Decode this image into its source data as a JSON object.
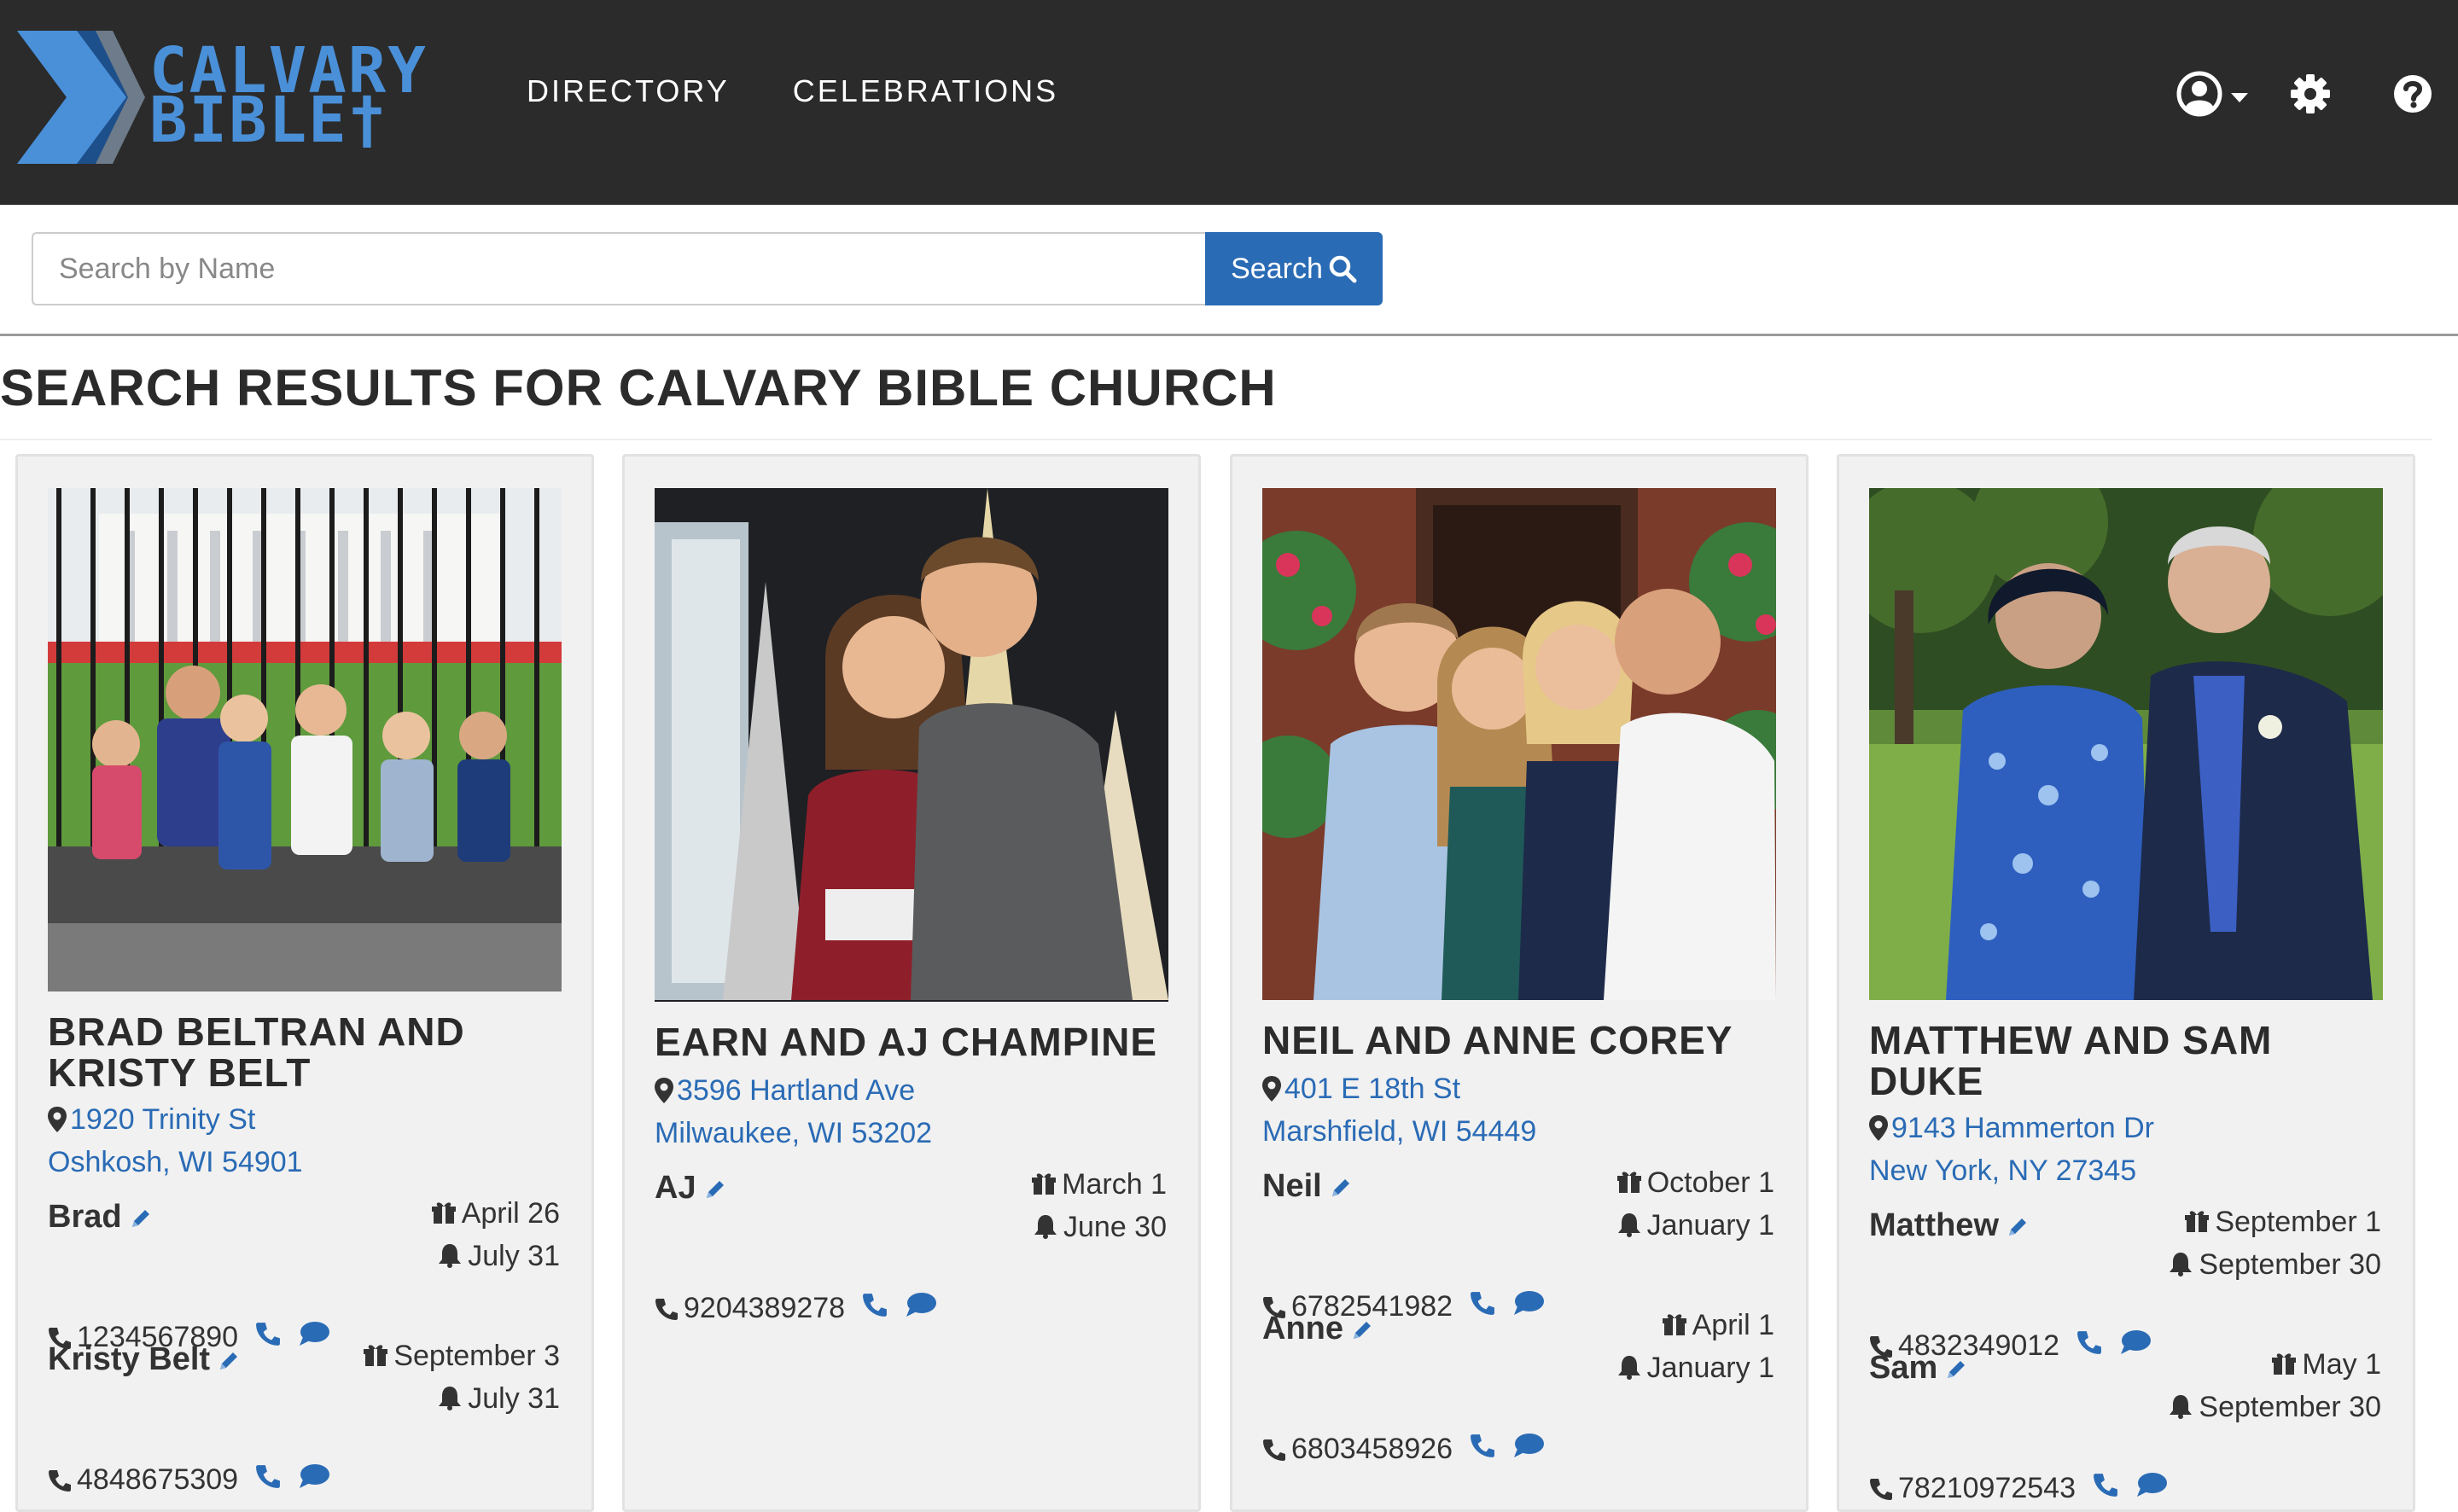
{
  "brand": {
    "line1": "CALVARY",
    "line2": "BIBLE†",
    "blue": "#4a90d9",
    "chevron_dark": "#1d4f8a"
  },
  "nav": {
    "links": [
      "DIRECTORY",
      "CELEBRATIONS"
    ],
    "icons": [
      "user-circle-icon",
      "caret-down-icon",
      "gear-icon",
      "question-circle-icon"
    ]
  },
  "search": {
    "placeholder": "Search by Name",
    "button_label": "Search",
    "value": ""
  },
  "results_title": "SEARCH RESULTS FOR CALVARY BIBLE CHURCH",
  "colors": {
    "navbar": "#2b2b2b",
    "link": "#2a6bb5",
    "card_bg": "#f1f1f1"
  },
  "cards": [
    {
      "name": "BRAD BELTRAN AND KRISTY BELT",
      "address": {
        "line1": "1920 Trinity St",
        "line2": "Oshkosh, WI 54901"
      },
      "members": [
        {
          "name": "Brad",
          "birthday": "April 26",
          "anniversary": "July 31",
          "phone": "1234567890"
        },
        {
          "name": "Kristy Belt",
          "birthday": "September 3",
          "anniversary": "July 31",
          "phone": "4848675309"
        }
      ]
    },
    {
      "name": "EARN AND AJ CHAMPINE",
      "address": {
        "line1": "3596 Hartland Ave",
        "line2": "Milwaukee, WI 53202"
      },
      "members": [
        {
          "name": "AJ",
          "birthday": "March 1",
          "anniversary": "June 30",
          "phone": "9204389278"
        }
      ]
    },
    {
      "name": "NEIL AND ANNE COREY",
      "address": {
        "line1": "401 E 18th St",
        "line2": "Marshfield, WI 54449"
      },
      "members": [
        {
          "name": "Neil",
          "birthday": "October 1",
          "anniversary": "January 1",
          "phone": "6782541982"
        },
        {
          "name": "Anne",
          "birthday": "April 1",
          "anniversary": "January 1",
          "phone": "6803458926"
        }
      ]
    },
    {
      "name": "MATTHEW AND SAM DUKE",
      "address": {
        "line1": "9143 Hammerton Dr",
        "line2": "New York, NY 27345"
      },
      "members": [
        {
          "name": "Matthew",
          "birthday": "September 1",
          "anniversary": "September 30",
          "phone": "4832349012"
        },
        {
          "name": "Sam",
          "birthday": "May 1",
          "anniversary": "September 30",
          "phone": "78210972543"
        }
      ]
    }
  ]
}
